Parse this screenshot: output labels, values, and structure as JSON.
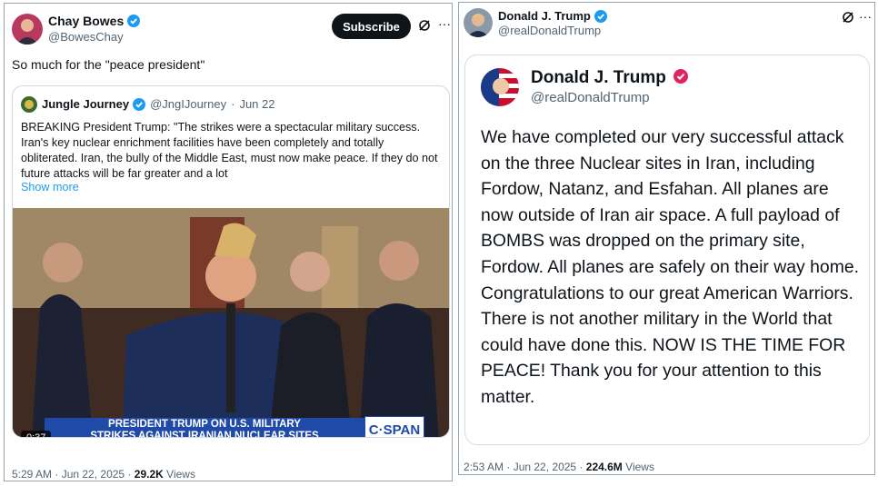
{
  "left_tweet": {
    "author_name": "Chay Bowes",
    "author_handle": "@BowesChay",
    "subscribe_label": "Subscribe",
    "text": "So much for the \"peace president\"",
    "quote": {
      "author_name": "Jungle Journey",
      "author_handle": "@JngIJourney",
      "separator": "·",
      "date": "Jun 22",
      "text": "BREAKING President Trump: \"The strikes were a spectacular military success. Iran's key nuclear enrichment facilities have been completely and totally obliterated. Iran, the bully of the Middle East, must now make peace. If they do not future attacks will be far greater and a lot",
      "show_more": "Show more",
      "video": {
        "duration": "0:37",
        "chyron_line1": "PRESIDENT TRUMP ON U.S. MILITARY",
        "chyron_line2": "STRIKES AGAINST IRANIAN NUCLEAR SITES",
        "network": "C·SPAN"
      }
    },
    "time": "5:29 AM",
    "date": "Jun 22, 2025",
    "views_count": "29.2K",
    "views_label": "Views"
  },
  "right_tweet": {
    "author_name": "Donald J. Trump",
    "author_handle": "@realDonaldTrump",
    "card": {
      "author_name": "Donald J. Trump",
      "author_handle": "@realDonaldTrump",
      "text": "We have completed our very successful attack on the three Nuclear sites in Iran, including Fordow, Natanz, and Esfahan. All planes are now outside of Iran air space. A full payload of BOMBS was dropped on the primary site, Fordow. All planes are safely on their way home. Congratulations to our great American Warriors. There is not another military in the World that could have done this. NOW IS THE TIME FOR PEACE! Thank you for your attention to this matter."
    },
    "time": "2:53 AM",
    "date": "Jun 22, 2025",
    "views_count": "224.6M",
    "views_label": "Views"
  },
  "icons": [
    "verified-badge-icon",
    "grok-icon",
    "more-icon"
  ],
  "colors": {
    "accent": "#1d9bf0",
    "text": "#0f1419",
    "muted": "#536471",
    "verified_pink": "#e0245e",
    "chyron_blue": "#1f4aa8"
  }
}
